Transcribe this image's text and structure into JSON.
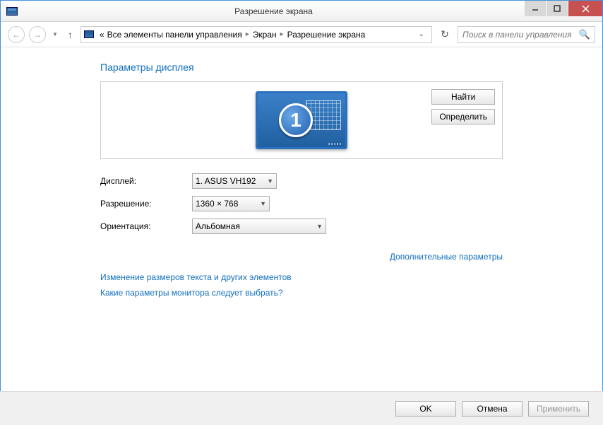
{
  "window": {
    "title": "Разрешение экрана"
  },
  "breadcrumb": {
    "prefix": "«",
    "items": [
      "Все элементы панели управления",
      "Экран",
      "Разрешение экрана"
    ]
  },
  "search": {
    "placeholder": "Поиск в панели управления"
  },
  "heading": "Параметры дисплея",
  "preview": {
    "monitor_number": "1",
    "buttons": {
      "detect": "Найти",
      "identify": "Определить"
    }
  },
  "form": {
    "display_label": "Дисплей:",
    "display_value": "1. ASUS VH192",
    "resolution_label": "Разрешение:",
    "resolution_value": "1360 × 768",
    "orientation_label": "Ориентация:",
    "orientation_value": "Альбомная"
  },
  "links": {
    "advanced": "Дополнительные параметры",
    "text_size": "Изменение размеров текста и других элементов",
    "which_settings": "Какие параметры монитора следует выбрать?"
  },
  "footer": {
    "ok": "OK",
    "cancel": "Отмена",
    "apply": "Применить"
  }
}
